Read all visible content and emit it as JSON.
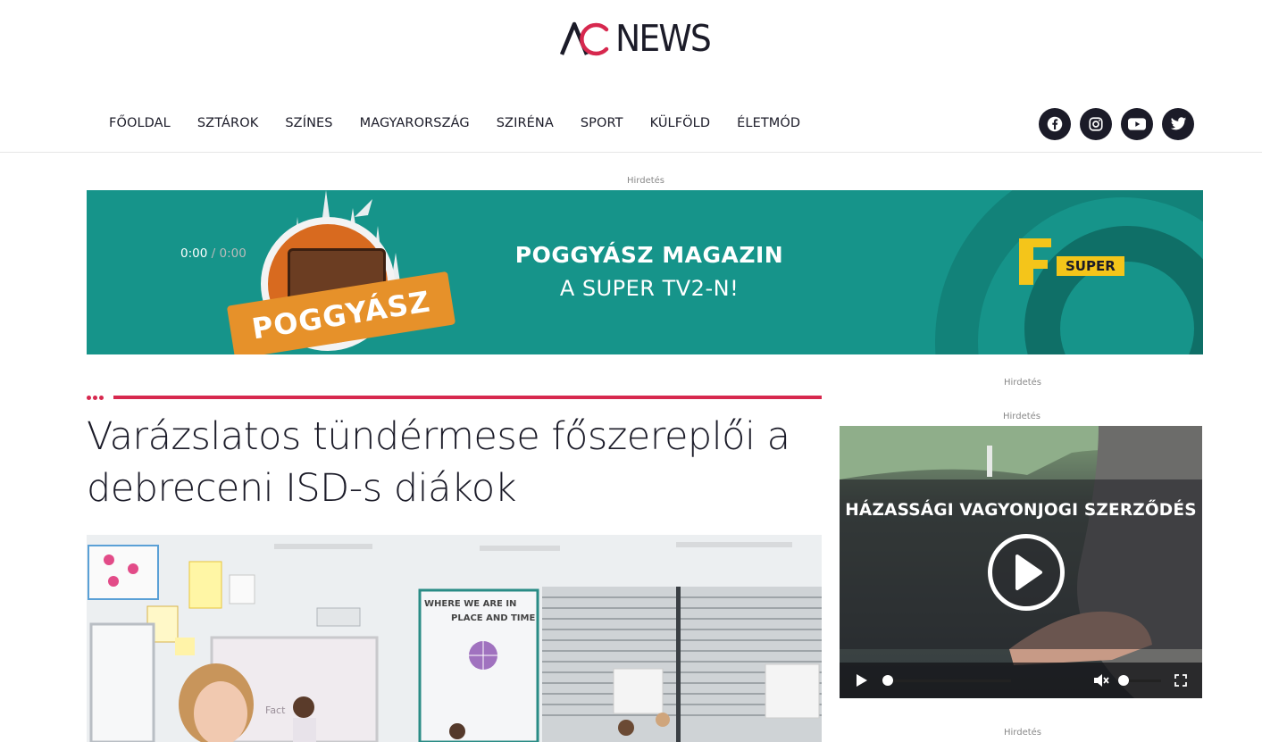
{
  "site": {
    "logo_text": "NEWS",
    "logo_mark": "AC"
  },
  "nav": {
    "items": [
      "FŐOLDAL",
      "SZTÁROK",
      "SZÍNES",
      "MAGYARORSZÁG",
      "SZIRÉNA",
      "SPORT",
      "KÜLFÖLD",
      "ÉLETMÓD"
    ]
  },
  "social": {
    "icons": [
      "facebook-icon",
      "instagram-icon",
      "youtube-icon",
      "twitter-icon"
    ]
  },
  "ads": {
    "label": "Hirdetés"
  },
  "banner": {
    "title": "POGGYÁSZ MAGAZIN",
    "subtitle": "A SUPER TV2-N!",
    "ribbon": "POGGYÁSZ",
    "channel": "SUPER"
  },
  "article": {
    "headline": "Varázslatos tündérmese főszereplői a debreceni ISD-s diákok"
  },
  "video": {
    "title": "HÁZASSÁGI VAGYONJOGI SZERZŐDÉS",
    "current_time": "0:00",
    "separator": "/",
    "duration": "0:00"
  },
  "colors": {
    "accent": "#d7284e",
    "dark": "#1b1b28",
    "banner_teal": "#16948a"
  }
}
